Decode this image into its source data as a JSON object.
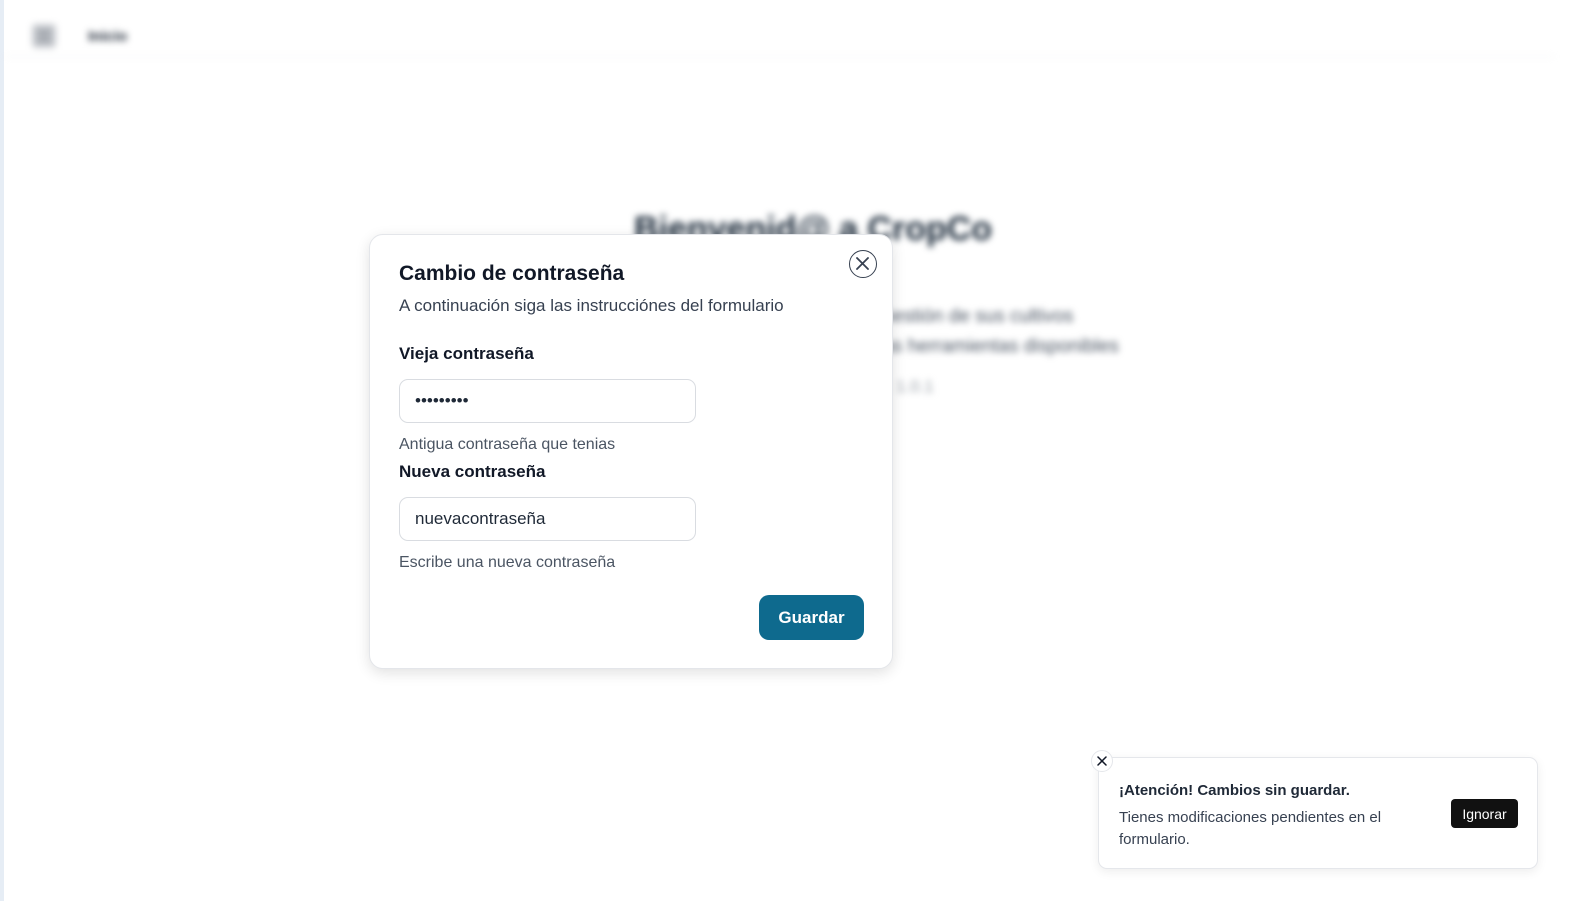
{
  "background": {
    "topbar_title": "Inicio",
    "welcome_title": "Bienvenid@ a CropCo",
    "welcome_line_1": "Gestión de sus cultivos",
    "welcome_line_2": "las herramientas disponibles",
    "welcome_line_3": "v: 1.0.1"
  },
  "dialog": {
    "title": "Cambio de contraseña",
    "subtitle": "A continuación siga las instrucciónes del formulario",
    "old_password": {
      "label": "Vieja contraseña",
      "value": "•••••••••",
      "help": "Antigua contraseña que tenias"
    },
    "new_password": {
      "label": "Nueva contraseña",
      "value": "nuevacontraseña",
      "help": "Escribe una nueva contraseña"
    },
    "save_label": "Guardar",
    "close_icon": "close-circle-icon"
  },
  "toast": {
    "title": "¡Atención! Cambios sin guardar.",
    "message": "Tienes modificaciones pendientes en el formulario.",
    "action_label": "Ignorar",
    "close_icon": "x-icon"
  },
  "colors": {
    "primary": "#0e6a8e",
    "toast_button": "#111111"
  }
}
